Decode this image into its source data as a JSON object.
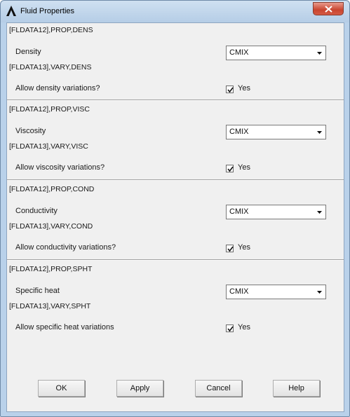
{
  "window": {
    "title": "Fluid Properties"
  },
  "sections": [
    {
      "prop_cmd": "[FLDATA12],PROP,DENS",
      "label": "Density",
      "select_value": "CMIX",
      "vary_cmd": "[FLDATA13],VARY,DENS",
      "vary_label": "Allow density variations?",
      "checked": true,
      "check_label": "Yes"
    },
    {
      "prop_cmd": "[FLDATA12],PROP,VISC",
      "label": "Viscosity",
      "select_value": "CMIX",
      "vary_cmd": "[FLDATA13],VARY,VISC",
      "vary_label": "Allow viscosity variations?",
      "checked": true,
      "check_label": "Yes"
    },
    {
      "prop_cmd": "[FLDATA12],PROP,COND",
      "label": "Conductivity",
      "select_value": "CMIX",
      "vary_cmd": "[FLDATA13],VARY,COND",
      "vary_label": "Allow conductivity variations?",
      "checked": true,
      "check_label": "Yes"
    },
    {
      "prop_cmd": "[FLDATA12],PROP,SPHT",
      "label": "Specific heat",
      "select_value": "CMIX",
      "vary_cmd": "[FLDATA13],VARY,SPHT",
      "vary_label": "Allow specific heat variations",
      "checked": true,
      "check_label": "Yes"
    }
  ],
  "buttons": {
    "ok": "OK",
    "apply": "Apply",
    "cancel": "Cancel",
    "help": "Help"
  },
  "colors": {
    "frame": "#b9d1ea",
    "client": "#f0f0f0",
    "close": "#c9452f"
  },
  "icons": {
    "app": "ansys-logo-icon",
    "close": "close-icon",
    "dropdown": "dropdown-arrow-icon",
    "check": "checkmark-icon"
  }
}
